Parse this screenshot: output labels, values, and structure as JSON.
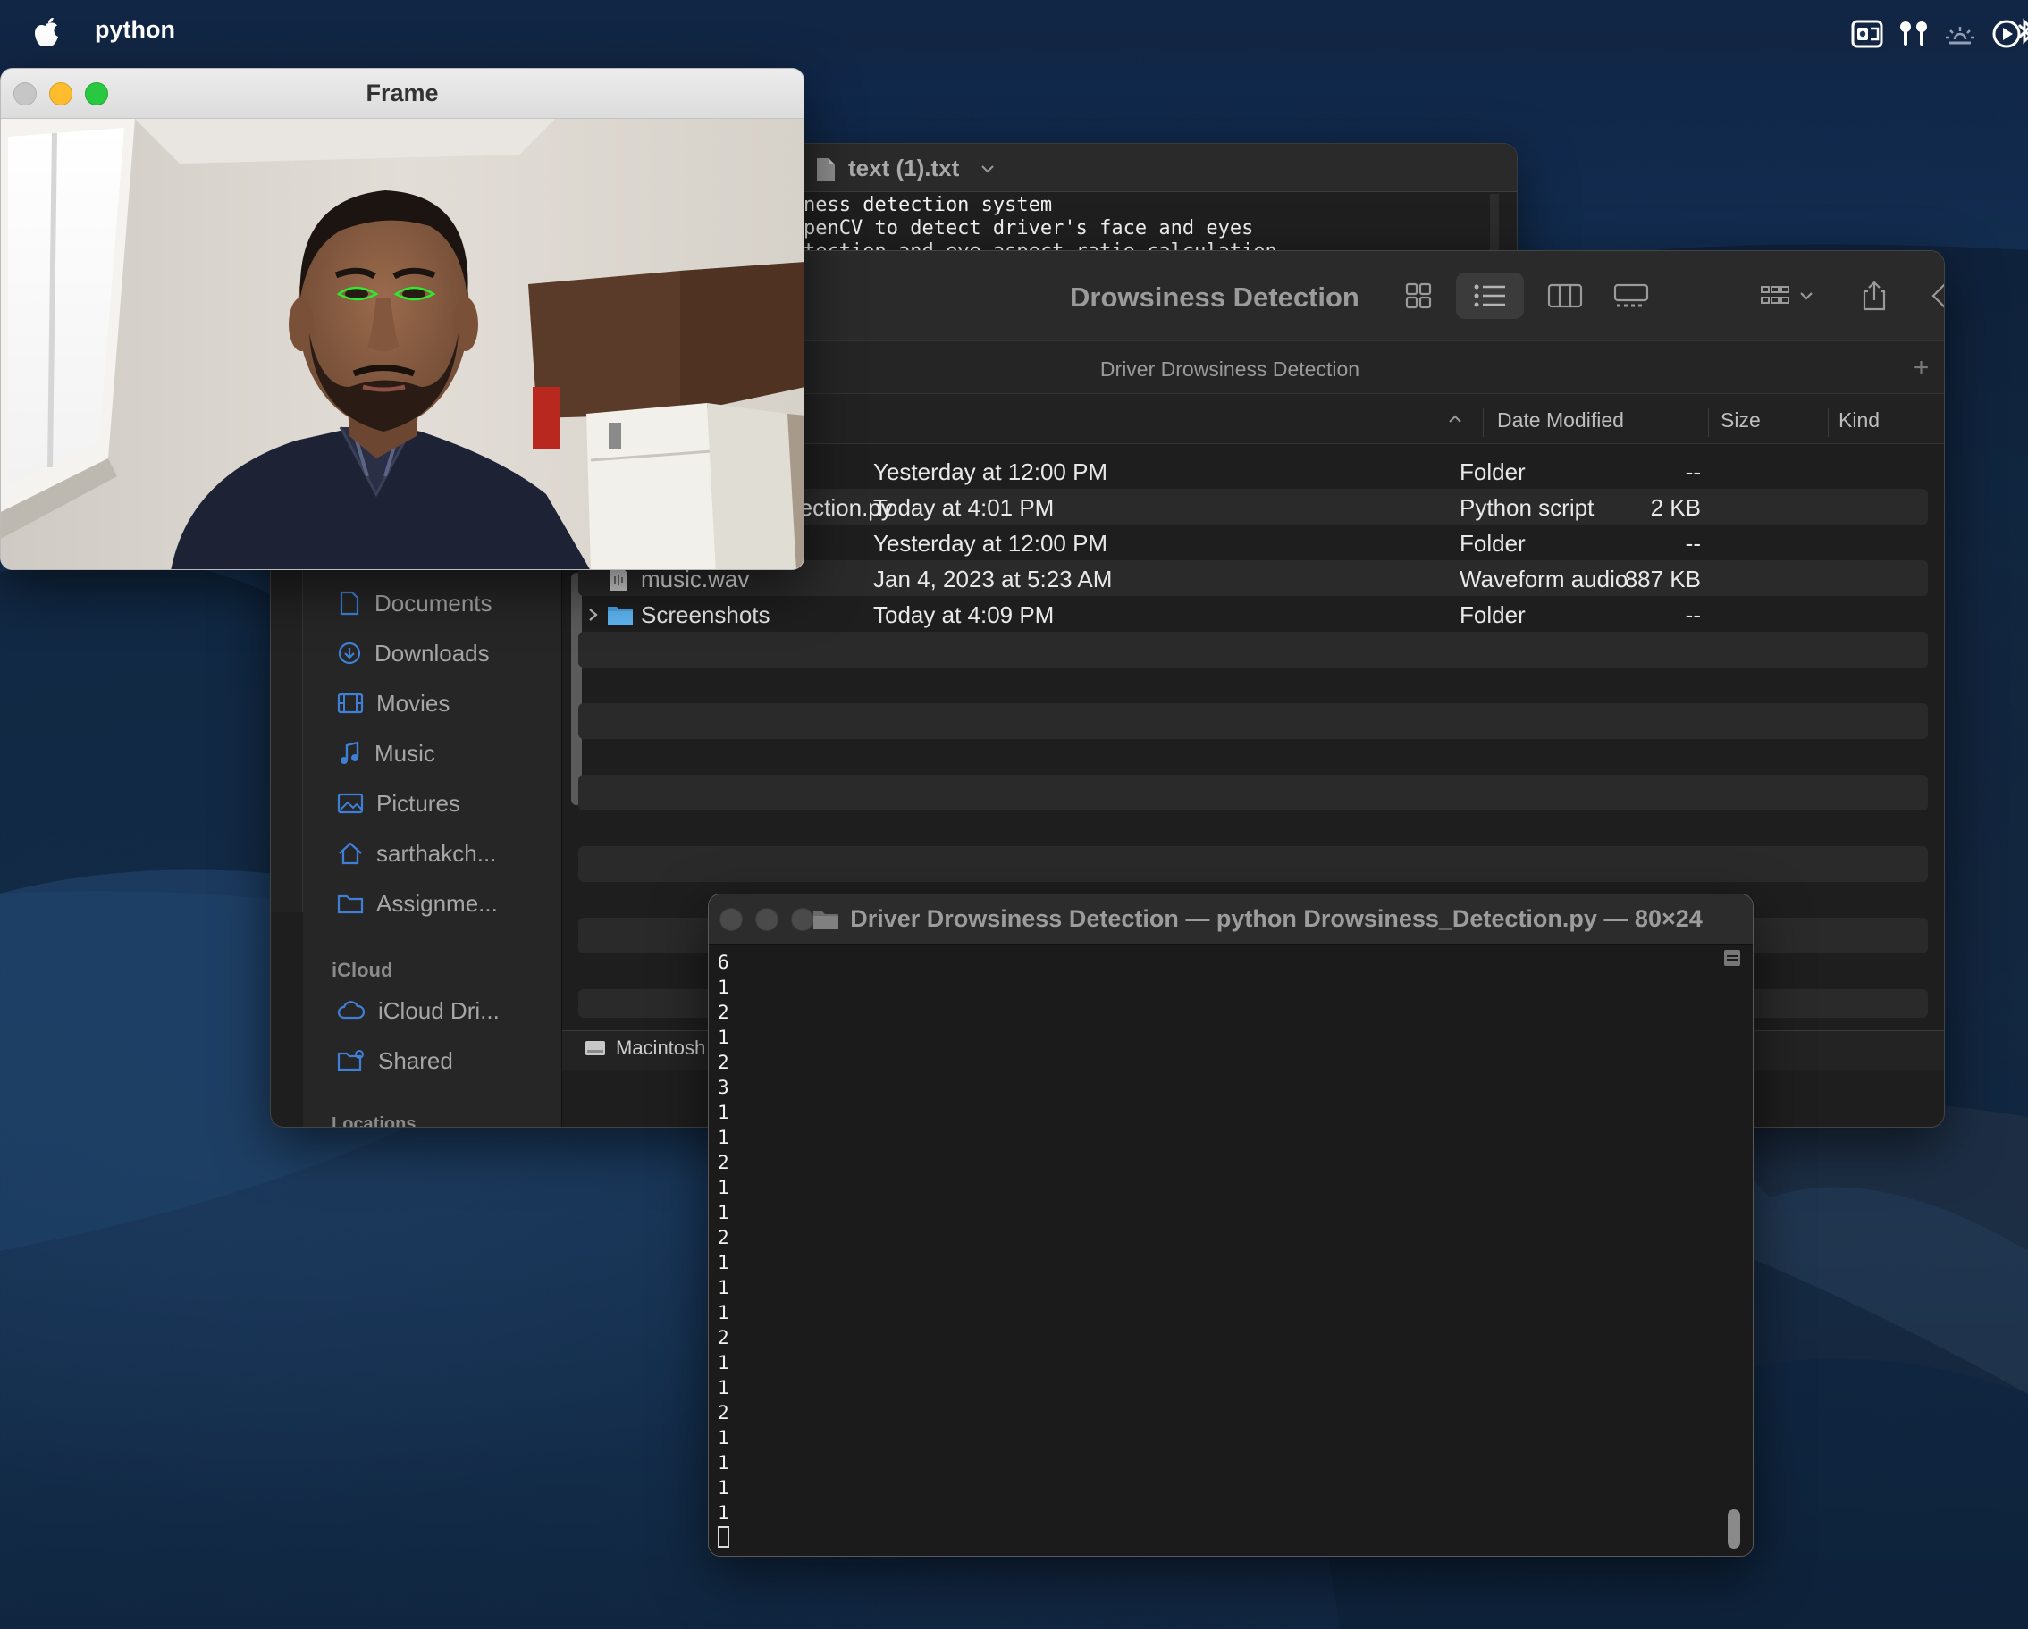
{
  "menubar": {
    "app_name": "python"
  },
  "text_editor": {
    "title": "text (1).txt",
    "lines": [
      "ness detection system",
      "penCV to detect driver's face and eyes",
      "tection and eye aspect ratio calculation"
    ]
  },
  "finder": {
    "window_title": "Drowsiness Detection",
    "path_title": "Driver Drowsiness Detection",
    "columns": {
      "date": "Date Modified",
      "size": "Size",
      "kind": "Kind"
    },
    "sidebar": {
      "items": [
        {
          "label": "Documents",
          "icon": "document-icon"
        },
        {
          "label": "Downloads",
          "icon": "download-icon"
        },
        {
          "label": "Movies",
          "icon": "film-icon"
        },
        {
          "label": "Music",
          "icon": "music-note-icon"
        },
        {
          "label": "Pictures",
          "icon": "picture-icon"
        },
        {
          "label": "sarthakch...",
          "icon": "home-icon"
        },
        {
          "label": "Assignme...",
          "icon": "folder-icon"
        }
      ],
      "icloud_header": "iCloud",
      "icloud_items": [
        {
          "label": "iCloud Dri...",
          "icon": "cloud-icon"
        },
        {
          "label": "Shared",
          "icon": "shared-folder-icon"
        }
      ],
      "locations_header": "Locations"
    },
    "files": [
      {
        "name": "",
        "date": "Yesterday at 12:00 PM",
        "size": "--",
        "kind": "Folder"
      },
      {
        "name": "etection.py",
        "date": "Today at 4:01 PM",
        "size": "2 KB",
        "kind": "Python script"
      },
      {
        "name": "",
        "date": "Yesterday at 12:00 PM",
        "size": "--",
        "kind": "Folder"
      },
      {
        "name": "music.wav",
        "date": "Jan 4, 2023 at 5:23 AM",
        "size": "887 KB",
        "kind": "Waveform audio"
      },
      {
        "name": "Screenshots",
        "date": "Today at 4:09 PM",
        "size": "--",
        "kind": "Folder"
      }
    ],
    "statusbar_disk": "Macintosh"
  },
  "frame_window": {
    "title": "Frame"
  },
  "terminal": {
    "title": "Driver Drowsiness Detection — python Drowsiness_Detection.py — 80×24",
    "output": "6\n1\n2\n1\n2\n3\n1\n1\n2\n1\n1\n2\n1\n1\n1\n2\n1\n1\n2\n1\n1\n1\n1"
  },
  "colors": {
    "traffic_close": "#ff5f57",
    "traffic_min": "#febc2e",
    "traffic_max": "#28c840",
    "eye_contour": "#2fe82f"
  }
}
